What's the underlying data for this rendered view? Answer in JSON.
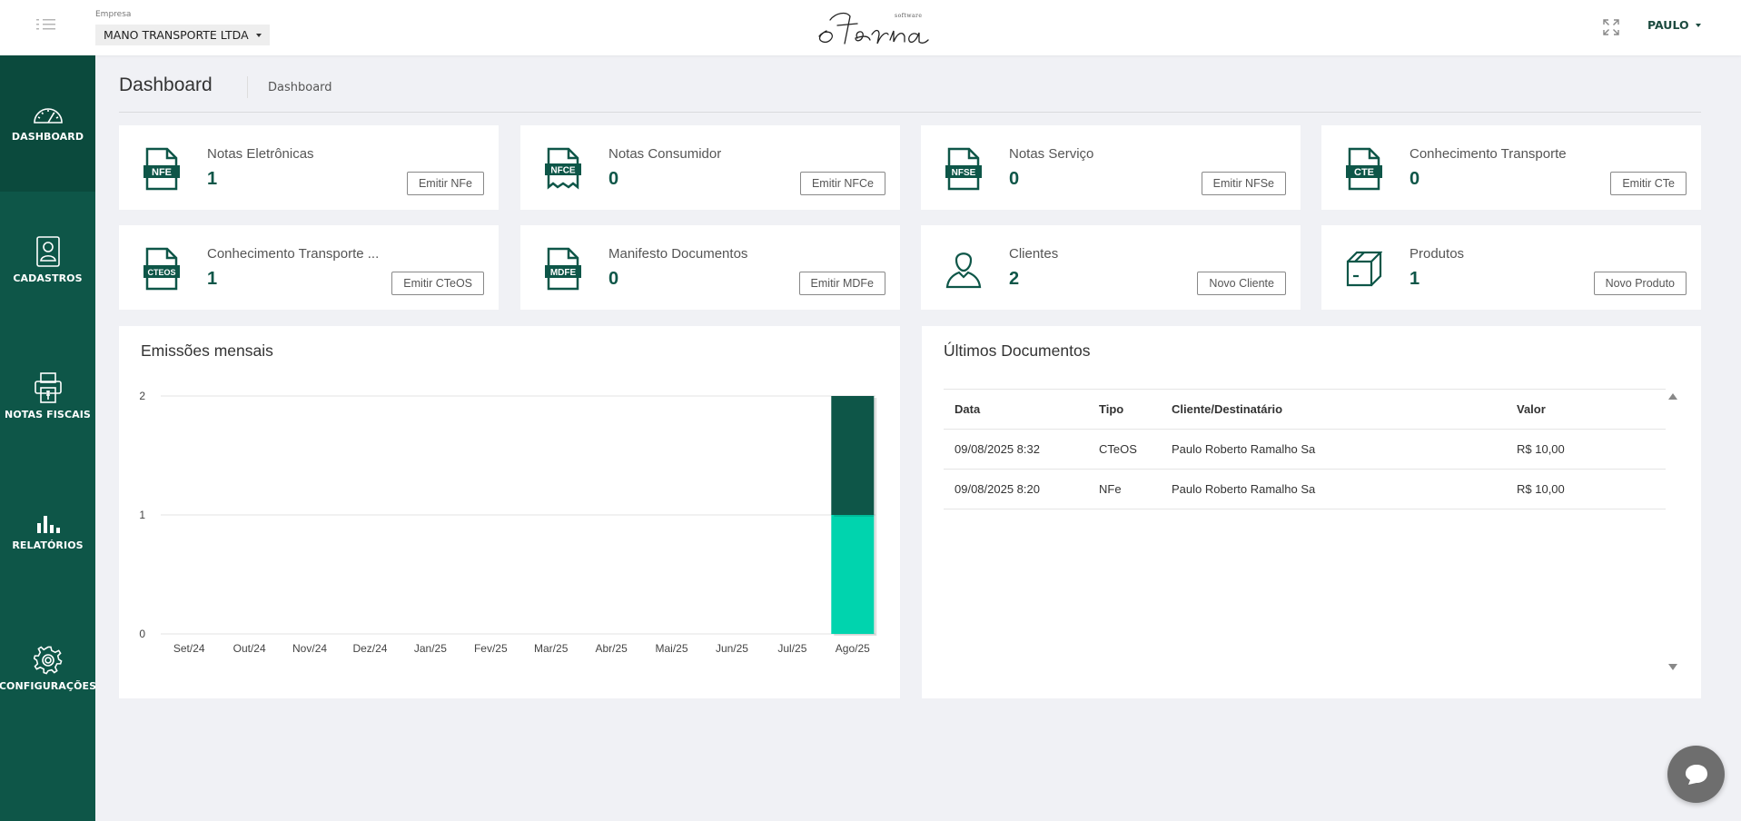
{
  "header": {
    "company_label": "Empresa",
    "company_name": "MANO TRANSPORTE LTDA",
    "logo_text": "eterna",
    "logo_subtext": "software",
    "user_name": "PAULO"
  },
  "sidebar": {
    "items": [
      {
        "label": "DASHBOARD",
        "icon": "gauge-icon",
        "active": true
      },
      {
        "label": "CADASTROS",
        "icon": "user-card-icon"
      },
      {
        "label": "NOTAS FISCAIS",
        "icon": "printer-icon"
      },
      {
        "label": "RELATÓRIOS",
        "icon": "bar-chart-icon"
      },
      {
        "label": "CONFIGURAÇÕES",
        "icon": "gear-icon"
      }
    ]
  },
  "page": {
    "title": "Dashboard",
    "breadcrumb": "Dashboard"
  },
  "cards": [
    {
      "title": "Notas Eletrônicas",
      "count": "1",
      "button": "Emitir NFe",
      "icon_text": "NFE"
    },
    {
      "title": "Notas Consumidor",
      "count": "0",
      "button": "Emitir NFCe",
      "icon_text": "NFCE"
    },
    {
      "title": "Notas Serviço",
      "count": "0",
      "button": "Emitir NFSe",
      "icon_text": "NFSE"
    },
    {
      "title": "Conhecimento Transporte",
      "count": "0",
      "button": "Emitir CTe",
      "icon_text": "CTE"
    },
    {
      "title": "Conhecimento Transporte ...",
      "count": "1",
      "button": "Emitir CTeOS",
      "icon_text": "CTEOS"
    },
    {
      "title": "Manifesto Documentos",
      "count": "0",
      "button": "Emitir MDFe",
      "icon_text": "MDFE"
    },
    {
      "title": "Clientes",
      "count": "2",
      "button": "Novo Cliente",
      "icon_text": ""
    },
    {
      "title": "Produtos",
      "count": "1",
      "button": "Novo Produto",
      "icon_text": ""
    }
  ],
  "chart_panel": {
    "title": "Emissões mensais"
  },
  "chart_data": {
    "type": "bar",
    "stacked": true,
    "categories": [
      "Set/24",
      "Out/24",
      "Nov/24",
      "Dez/24",
      "Jan/25",
      "Fev/25",
      "Mar/25",
      "Abr/25",
      "Mai/25",
      "Jun/25",
      "Jul/25",
      "Ago/25"
    ],
    "series": [
      {
        "values": [
          0,
          0,
          0,
          0,
          0,
          0,
          0,
          0,
          0,
          0,
          0,
          1
        ],
        "color": "#00d4ae"
      },
      {
        "values": [
          0,
          0,
          0,
          0,
          0,
          0,
          0,
          0,
          0,
          0,
          0,
          1
        ],
        "color": "#0e5648"
      }
    ],
    "ylim": [
      0,
      2
    ],
    "yticks": [
      "0",
      "1",
      "2"
    ],
    "grid": true
  },
  "docs_panel": {
    "title": "Últimos Documentos",
    "columns": [
      "Data",
      "Tipo",
      "Cliente/Destinatário",
      "Valor"
    ],
    "rows": [
      [
        "09/08/2025 8:32",
        "CTeOS",
        "Paulo Roberto Ramalho Sa",
        "R$ 10,00"
      ],
      [
        "09/08/2025 8:20",
        "NFe",
        "Paulo Roberto Ramalho Sa",
        "R$ 10,00"
      ]
    ]
  },
  "colors": {
    "sidebar": "#0e5648",
    "accent": "#0e5648",
    "bar_light": "#00d4ae"
  }
}
